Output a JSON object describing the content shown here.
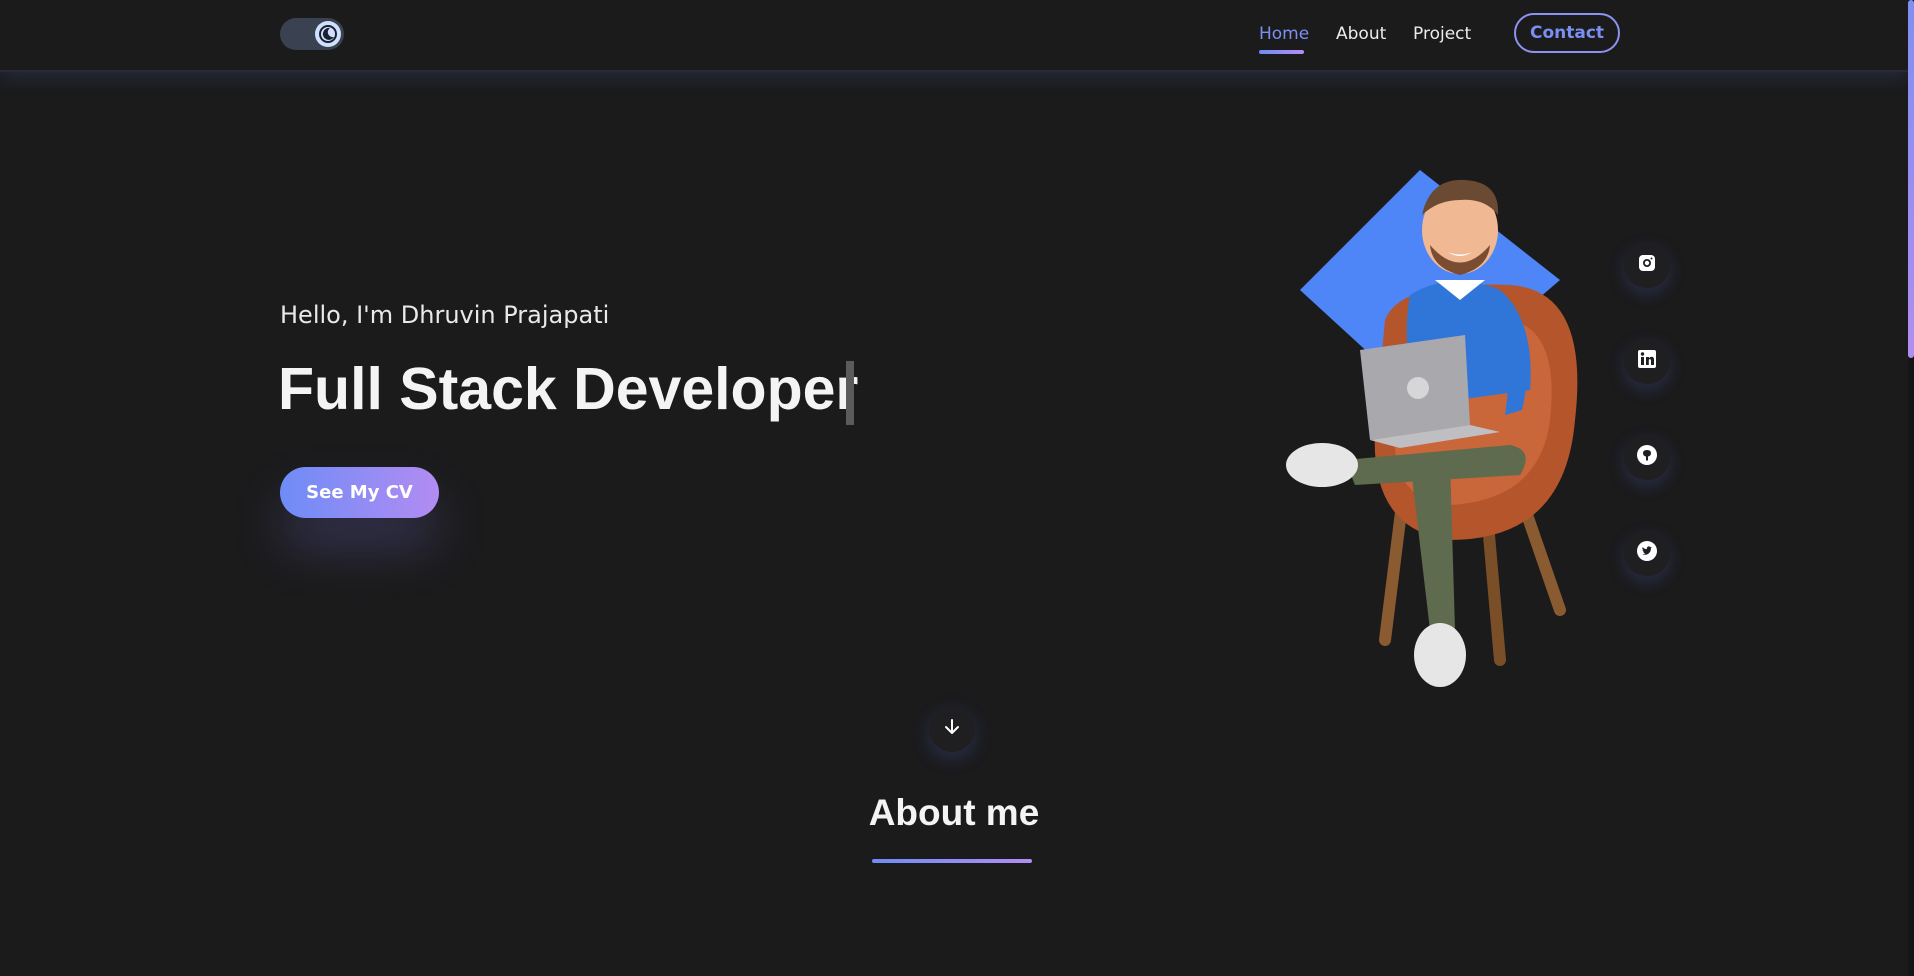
{
  "nav": {
    "items": [
      {
        "label": "Home"
      },
      {
        "label": "About"
      },
      {
        "label": "Project"
      }
    ],
    "contact_label": "Contact",
    "active_color": "#7c8ff0"
  },
  "theme_toggle": {
    "icon": "moon-icon",
    "state": "dark"
  },
  "hero": {
    "greeting": "Hello, I'm Dhruvin Prajapati",
    "headline": "Full Stack Developer",
    "cv_button": "See My CV",
    "illustration_icon": "developer-avatar-illustration"
  },
  "social": [
    {
      "icon": "instagram-icon"
    },
    {
      "icon": "linkedin-icon"
    },
    {
      "icon": "github-icon"
    },
    {
      "icon": "twitter-icon"
    }
  ],
  "scroll_icon": "arrow-down-icon",
  "about": {
    "title": "About me"
  },
  "colors": {
    "background": "#1b1b1c",
    "accent_start": "#6e8cf6",
    "accent_end": "#b28cf2",
    "diamond": "#4f86f7"
  }
}
